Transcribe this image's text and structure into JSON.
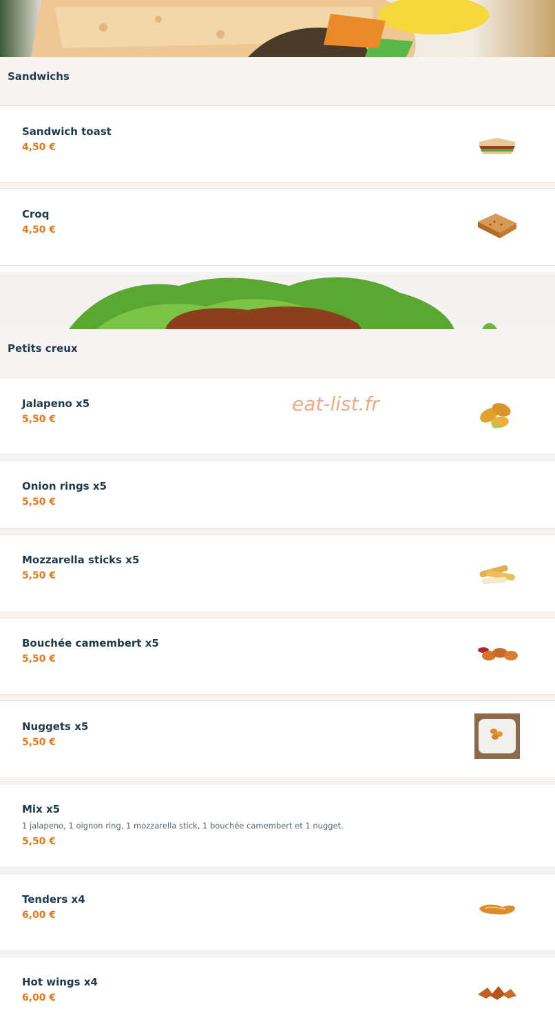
{
  "watermark": "eat-list.fr",
  "sections": [
    {
      "title": "Sandwichs",
      "banner_icon": "sandwich-banner-image",
      "items": [
        {
          "name": "Sandwich toast",
          "price": "4,50 €",
          "icon": "club-sandwich-photo"
        },
        {
          "name": "Croq",
          "price": "4,50 €",
          "icon": "croque-monsieur-photo"
        }
      ]
    },
    {
      "title": "Petits creux",
      "banner_icon": "chicken-salad-banner-image",
      "items": [
        {
          "name": "Jalapeno x5",
          "price": "5,50 €",
          "icon": "jalapeno-poppers-photo"
        },
        {
          "name": "Onion rings x5",
          "price": "5,50 €"
        },
        {
          "name": "Mozzarella sticks x5",
          "price": "5,50 €",
          "icon": "mozzarella-sticks-photo"
        },
        {
          "name": "Bouchée camembert x5",
          "price": "5,50 €",
          "icon": "camembert-bites-photo"
        },
        {
          "name": "Nuggets x5",
          "price": "5,50 €",
          "icon": "nuggets-plate-photo"
        },
        {
          "name": "Mix x5",
          "description": "1 jalapeno, 1 oignon ring, 1 mozzarella stick, 1 bouchée camembert et 1 nugget.",
          "price": "5,50 €"
        },
        {
          "name": "Tenders x4",
          "price": "6,00 €",
          "icon": "tenders-photo"
        },
        {
          "name": "Hot wings x4",
          "price": "6,00 €",
          "icon": "hot-wings-photo"
        }
      ]
    }
  ],
  "colors": {
    "price": "#e8781a",
    "title": "#1e3b4c",
    "header_bg": "#f7f4f1"
  }
}
